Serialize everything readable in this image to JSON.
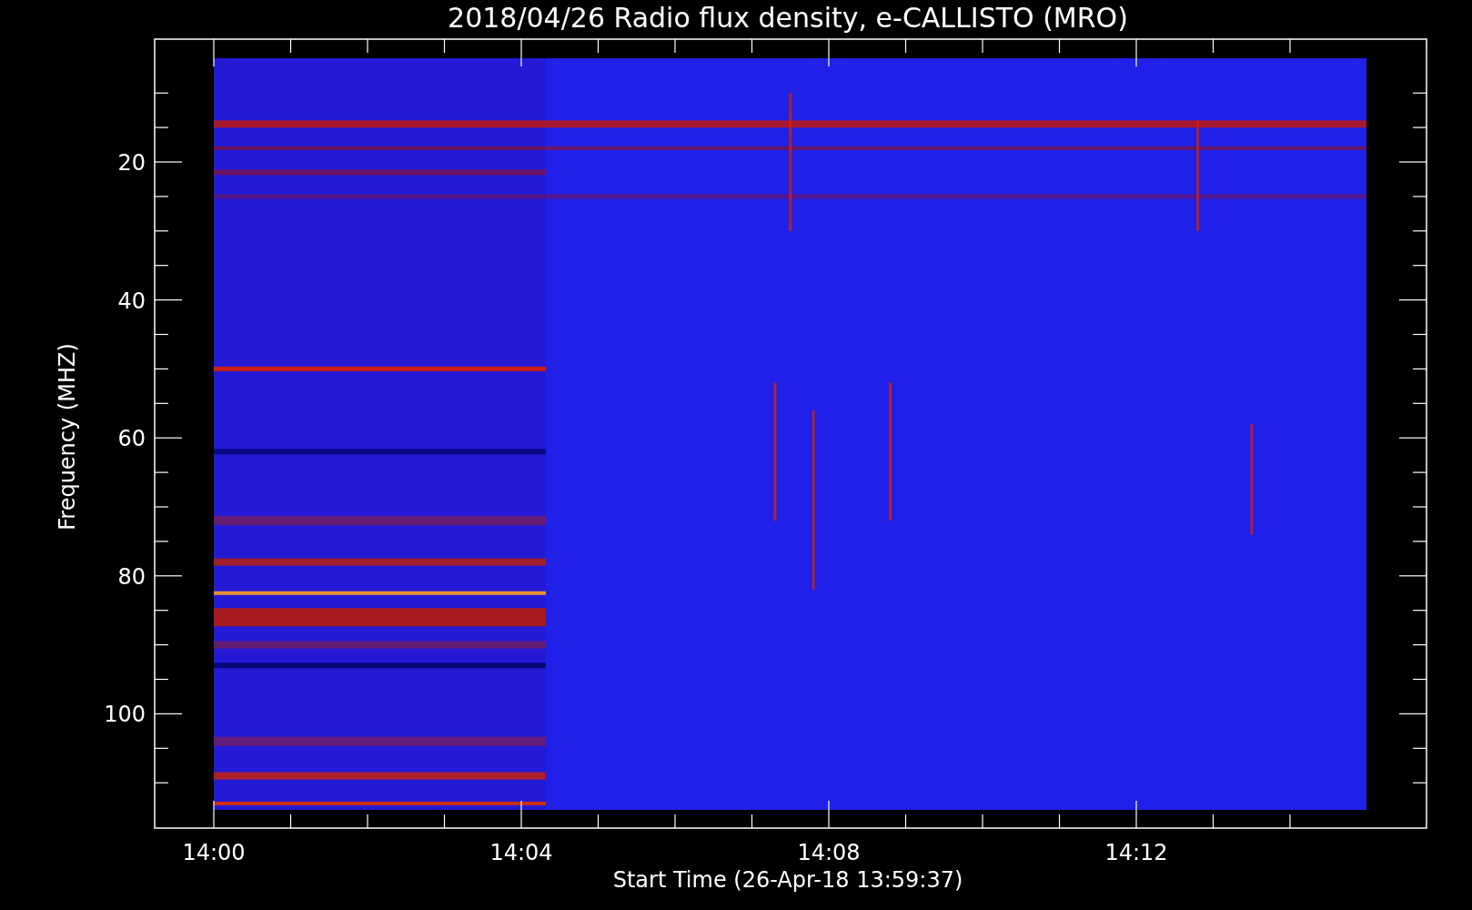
{
  "title": "2018/04/26  Radio flux density, e-CALLISTO (MRO)",
  "y_axis": {
    "label": "Frequency (MHZ)",
    "ticks": [
      "20",
      "40",
      "60",
      "80",
      "100"
    ]
  },
  "x_axis": {
    "label": "Start Time (26-Apr-18 13:59:37)",
    "ticks": [
      "14:00",
      "14:04",
      "14:08",
      "14:12"
    ]
  }
}
